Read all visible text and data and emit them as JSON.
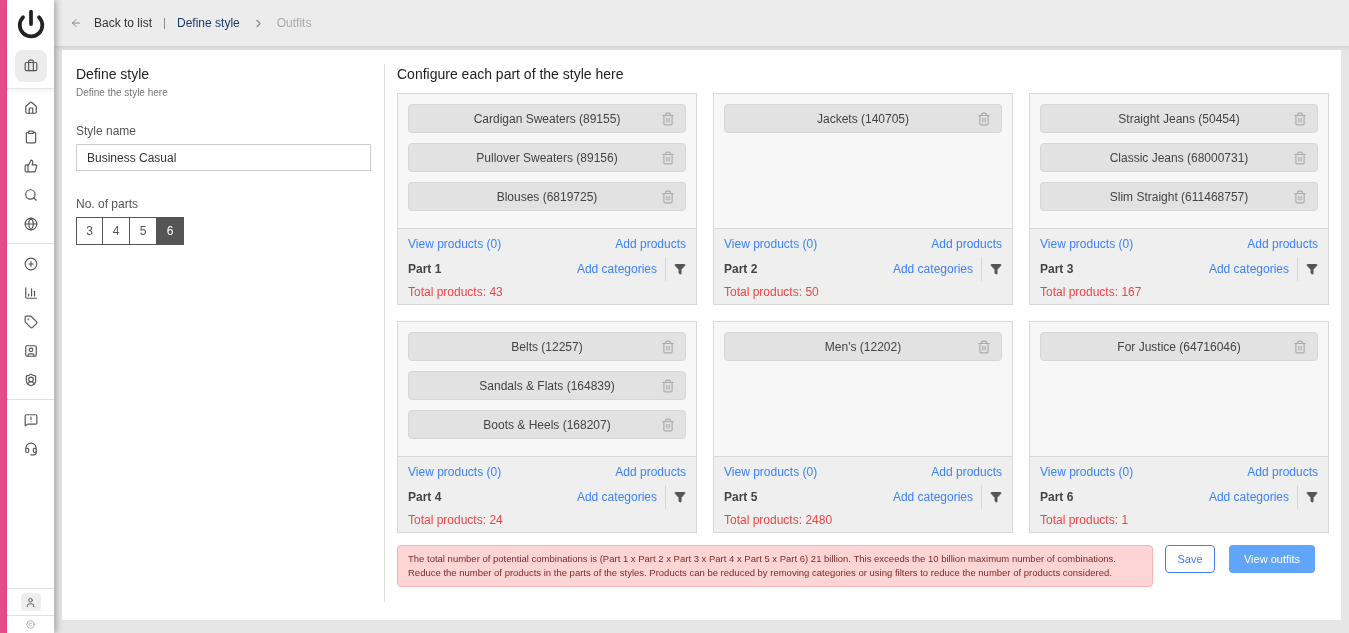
{
  "breadcrumb": {
    "back": "Back to list",
    "current": "Define style",
    "next": "Outfits"
  },
  "sidebar": {
    "items": [
      {
        "selected": true
      },
      {
        "selected": false
      },
      {
        "selected": false
      },
      {
        "selected": false
      },
      {
        "selected": false
      },
      {
        "selected": false
      },
      {
        "selected": false
      },
      {
        "selected": false
      },
      {
        "selected": false
      },
      {
        "selected": false
      },
      {
        "selected": false
      },
      {
        "selected": false
      },
      {
        "selected": false
      }
    ]
  },
  "form": {
    "title": "Define style",
    "subtitle": "Define the style here",
    "style_name_label": "Style name",
    "style_name": "Business Casual",
    "parts_label": "No. of parts",
    "part_options": [
      {
        "label": "3",
        "selected": false
      },
      {
        "label": "4",
        "selected": false
      },
      {
        "label": "5",
        "selected": false
      },
      {
        "label": "6",
        "selected": true
      }
    ]
  },
  "configure_title": "Configure each part of the style here",
  "parts": [
    {
      "name": "Part 1",
      "categories": [
        "Cardigan Sweaters (89155)",
        "Pullover Sweaters (89156)",
        "Blouses (6819725)"
      ],
      "view_products": "View products (0)",
      "add_products": "Add products",
      "add_categories": "Add categories",
      "total": "Total products: 43"
    },
    {
      "name": "Part 2",
      "categories": [
        "Jackets (140705)"
      ],
      "view_products": "View products (0)",
      "add_products": "Add products",
      "add_categories": "Add categories",
      "total": "Total products: 50"
    },
    {
      "name": "Part 3",
      "categories": [
        "Straight Jeans (50454)",
        "Classic Jeans (68000731)",
        "Slim Straight (611468757)"
      ],
      "view_products": "View products (0)",
      "add_products": "Add products",
      "add_categories": "Add categories",
      "total": "Total products: 167"
    },
    {
      "name": "Part 4",
      "categories": [
        "Belts (12257)",
        "Sandals & Flats (164839)",
        "Boots & Heels (168207)"
      ],
      "view_products": "View products (0)",
      "add_products": "Add products",
      "add_categories": "Add categories",
      "total": "Total products: 24"
    },
    {
      "name": "Part 5",
      "categories": [
        "Men's (12202)"
      ],
      "view_products": "View products (0)",
      "add_products": "Add products",
      "add_categories": "Add categories",
      "total": "Total products: 2480"
    },
    {
      "name": "Part 6",
      "categories": [
        "For Justice (64716046)"
      ],
      "view_products": "View products (0)",
      "add_products": "Add products",
      "add_categories": "Add categories",
      "total": "Total products: 1"
    }
  ],
  "alert": "The total number of potential combinations is (Part 1 x Part 2 x Part 3 x Part 4 x Part 5 x Part 6) 21 billion. This exceeds the 10 billion maximum number of combinations. Reduce the number of products in the parts of the styles. Products can be reduced by removing categories or using filters to reduce the number of products considered.",
  "buttons": {
    "save": "Save",
    "view_outfits": "View outfits"
  }
}
